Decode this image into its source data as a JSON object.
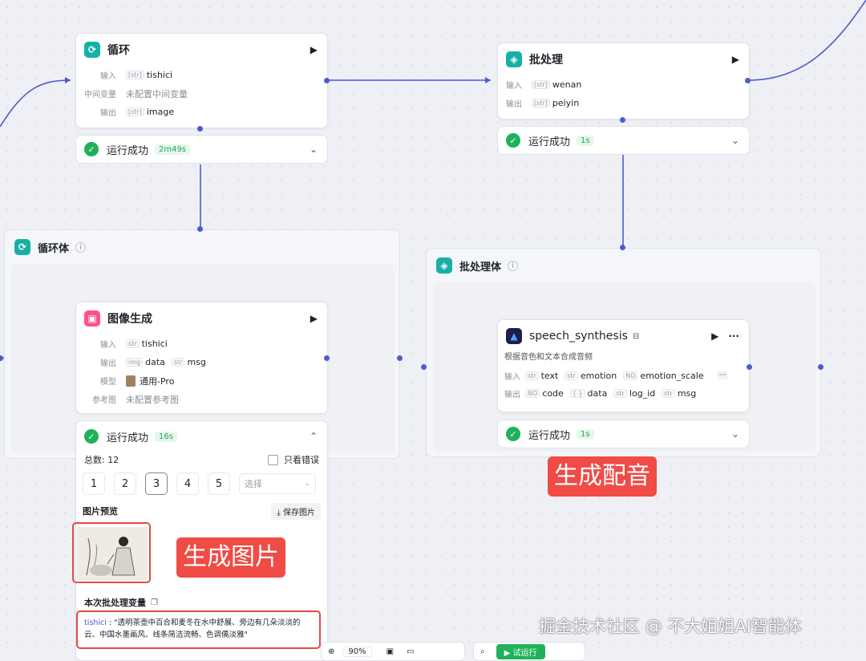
{
  "nodes": {
    "loop": {
      "title": "循环",
      "input_label": "输入",
      "input_type": "[str]",
      "input_value": "tishici",
      "mid_label": "中间变量",
      "mid_value": "未配置中间变量",
      "output_label": "输出",
      "output_type": "[str]",
      "output_value": "image",
      "status": "运行成功",
      "duration": "2m49s"
    },
    "batch": {
      "title": "批处理",
      "input_label": "输入",
      "input_type": "[str]",
      "input_value": "wenan",
      "output_label": "输出",
      "output_type": "[str]",
      "output_value": "peiyin",
      "status": "运行成功",
      "duration": "1s"
    },
    "loop_body": {
      "title": "循环体"
    },
    "batch_body": {
      "title": "批处理体"
    },
    "image_gen": {
      "title": "图像生成",
      "input_label": "输入",
      "input_type": "str",
      "input_value": "tishici",
      "output_label": "输出",
      "output1_type": "img",
      "output1_value": "data",
      "output2_type": "str",
      "output2_value": "msg",
      "model_label": "模型",
      "model_value": "通用-Pro",
      "ref_label": "参考图",
      "ref_value": "未配置参考图",
      "status": "运行成功",
      "duration": "16s",
      "total": "总数: 12",
      "only_errors": "只看错误",
      "pages": [
        "1",
        "2",
        "3",
        "4",
        "5"
      ],
      "select_placeholder": "选择",
      "preview_label": "图片预览",
      "save_label": "保存图片",
      "batch_var_label": "本次批处理变量",
      "batch_var_key": "tishici",
      "batch_var_text": "\"透明茶壶中百合和麦冬在水中舒展、旁边有几朵淡淡的云、中国水墨画风、线条简洁流畅、色调儒淡雅\""
    },
    "speech": {
      "title": "speech_synthesis",
      "desc": "根据音色和文本合成音频",
      "input_label": "输入",
      "output_label": "输出",
      "inputs": [
        {
          "type": "str",
          "name": "text"
        },
        {
          "type": "str",
          "name": "emotion"
        },
        {
          "type": "NO",
          "name": "emotion_scale"
        }
      ],
      "outputs": [
        {
          "type": "NO",
          "name": "code"
        },
        {
          "type": "{ }",
          "name": "data"
        },
        {
          "type": "str",
          "name": "log_id"
        },
        {
          "type": "str",
          "name": "msg"
        }
      ],
      "more": "···",
      "status": "运行成功",
      "duration": "1s"
    }
  },
  "overlays": {
    "gen_audio": "生成配音",
    "gen_image": "生成图片"
  },
  "watermark": "掘金技术社区 @ 不大姐姐AI智能体",
  "toolbar": {
    "zoom": "90%",
    "run_label": "试运行"
  },
  "colors": {
    "edge": "#4e5bd0",
    "success": "#1fb25a",
    "overlay": "#f04b45",
    "accent_teal": "#17b0a6"
  }
}
